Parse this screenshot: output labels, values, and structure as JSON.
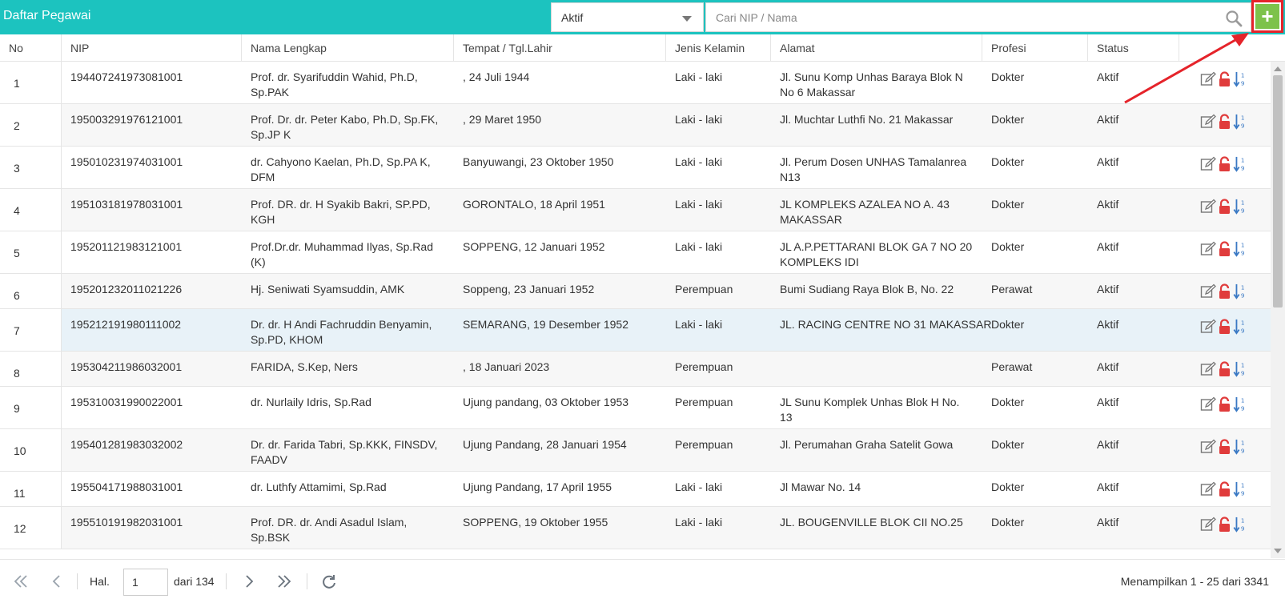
{
  "header": {
    "title": "Daftar Pegawai",
    "status_filter": "Aktif",
    "search_placeholder": "Cari NIP / Nama",
    "add_label": "+"
  },
  "columns": [
    "No",
    "NIP",
    "Nama Lengkap",
    "Tempat / Tgl.Lahir",
    "Jenis Kelamin",
    "Alamat",
    "Profesi",
    "Status"
  ],
  "rows": [
    {
      "no": "1",
      "nip": "194407241973081001",
      "nama": [
        "Prof. dr. Syarifuddin Wahid, Ph.D,",
        "Sp.PAK"
      ],
      "ttl": ", 24 Juli 1944",
      "jk": "Laki - laki",
      "alamat": [
        "Jl. Sunu Komp Unhas Baraya Blok N",
        "No 6 Makassar"
      ],
      "profesi": "Dokter",
      "status": "Aktif"
    },
    {
      "no": "2",
      "nip": "195003291976121001",
      "nama": [
        "Prof. Dr. dr. Peter Kabo, Ph.D, Sp.FK,",
        "Sp.JP K"
      ],
      "ttl": ", 29 Maret 1950",
      "jk": "Laki - laki",
      "alamat": [
        "Jl. Muchtar Luthfi No. 21 Makassar"
      ],
      "profesi": "Dokter",
      "status": "Aktif"
    },
    {
      "no": "3",
      "nip": "195010231974031001",
      "nama": [
        "dr. Cahyono Kaelan, Ph.D, Sp.PA K,",
        "DFM"
      ],
      "ttl": "Banyuwangi, 23 Oktober 1950",
      "jk": "Laki - laki",
      "alamat": [
        "Jl. Perum Dosen UNHAS Tamalanrea",
        "N13"
      ],
      "profesi": "Dokter",
      "status": "Aktif"
    },
    {
      "no": "4",
      "nip": "195103181978031001",
      "nama": [
        "Prof. DR. dr. H Syakib Bakri, SP.PD,",
        "KGH"
      ],
      "ttl": "GORONTALO, 18 April 1951",
      "jk": "Laki - laki",
      "alamat": [
        "JL KOMPLEKS AZALEA NO A. 43",
        "MAKASSAR"
      ],
      "profesi": "Dokter",
      "status": "Aktif"
    },
    {
      "no": "5",
      "nip": "195201121983121001",
      "nama": [
        "Prof.Dr.dr. Muhammad Ilyas, Sp.Rad",
        "(K)"
      ],
      "ttl": "SOPPENG, 12 Januari 1952",
      "jk": "Laki - laki",
      "alamat": [
        "JL A.P.PETTARANI BLOK GA 7 NO 20",
        "KOMPLEKS IDI"
      ],
      "profesi": "Dokter",
      "status": "Aktif"
    },
    {
      "no": "6",
      "nip": "195201232011021226",
      "nama": [
        "Hj. Seniwati Syamsuddin, AMK"
      ],
      "ttl": "Soppeng, 23 Januari 1952",
      "jk": "Perempuan",
      "alamat": [
        "Bumi Sudiang Raya Blok B, No. 22"
      ],
      "profesi": "Perawat",
      "status": "Aktif"
    },
    {
      "no": "7",
      "nip": "195212191980111002",
      "nama": [
        "Dr. dr. H Andi Fachruddin Benyamin,",
        "Sp.PD, KHOM"
      ],
      "ttl": "SEMARANG, 19 Desember 1952",
      "jk": "Laki - laki",
      "alamat": [
        "JL. RACING CENTRE NO 31 MAKASSAR"
      ],
      "profesi": "Dokter",
      "status": "Aktif"
    },
    {
      "no": "8",
      "nip": "195304211986032001",
      "nama": [
        "FARIDA, S.Kep, Ners"
      ],
      "ttl": ", 18 Januari 2023",
      "jk": "Perempuan",
      "alamat": [],
      "profesi": "Perawat",
      "status": "Aktif"
    },
    {
      "no": "9",
      "nip": "195310031990022001",
      "nama": [
        "dr. Nurlaily Idris, Sp.Rad"
      ],
      "ttl": "Ujung pandang, 03 Oktober 1953",
      "jk": "Perempuan",
      "alamat": [
        "JL Sunu Komplek Unhas Blok H No.",
        "13"
      ],
      "profesi": "Dokter",
      "status": "Aktif"
    },
    {
      "no": "10",
      "nip": "195401281983032002",
      "nama": [
        "Dr. dr. Farida Tabri, Sp.KKK, FINSDV,",
        "FAADV"
      ],
      "ttl": "Ujung Pandang, 28 Januari 1954",
      "jk": "Perempuan",
      "alamat": [
        "Jl. Perumahan Graha Satelit Gowa"
      ],
      "profesi": "Dokter",
      "status": "Aktif"
    },
    {
      "no": "11",
      "nip": "195504171988031001",
      "nama": [
        "dr. Luthfy Attamimi, Sp.Rad"
      ],
      "ttl": "Ujung Pandang, 17 April 1955",
      "jk": "Laki - laki",
      "alamat": [
        "Jl Mawar No. 14"
      ],
      "profesi": "Dokter",
      "status": "Aktif"
    },
    {
      "no": "12",
      "nip": "195510191982031001",
      "nama": [
        "Prof. DR. dr. Andi Asadul Islam,",
        "Sp.BSK"
      ],
      "ttl": "SOPPENG, 19 Oktober 1955",
      "jk": "Laki - laki",
      "alamat": [
        "JL. BOUGENVILLE BLOK CII NO.25"
      ],
      "profesi": "Dokter",
      "status": "Aktif"
    }
  ],
  "footer": {
    "page_label": "Hal.",
    "page_value": "1",
    "page_total": "dari 134",
    "summary": "Menampilkan 1 - 25 dari 3341"
  },
  "icons": {
    "edit": "edit-icon",
    "lock": "lock-icon",
    "sort": "sort-numeric-icon",
    "search": "search-icon",
    "refresh": "refresh-icon"
  },
  "colors": {
    "header_bg": "#1cc3bf",
    "add_button": "#7dc24b",
    "annotation": "#e5232a",
    "lock": "#e03c3c",
    "sort": "#3a79c4"
  }
}
